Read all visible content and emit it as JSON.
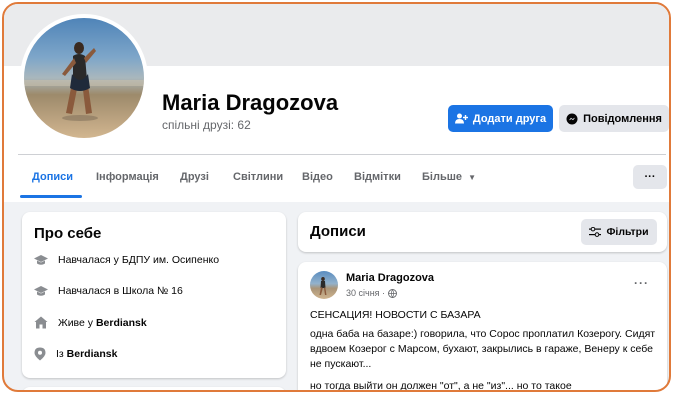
{
  "profile": {
    "name": "Maria Dragozova",
    "mutual_friends": "спільні друзі: 62"
  },
  "actions": {
    "add_friend": "Додати друга",
    "message": "Повідомлення"
  },
  "tabs": [
    {
      "label": "Дописи",
      "active": true
    },
    {
      "label": "Інформація",
      "active": false
    },
    {
      "label": "Друзі",
      "active": false
    },
    {
      "label": "Світлини",
      "active": false
    },
    {
      "label": "Відео",
      "active": false
    },
    {
      "label": "Відмітки",
      "active": false
    },
    {
      "label": "Більше",
      "active": false
    }
  ],
  "more_button": "···",
  "about": {
    "title": "Про себе",
    "items": [
      {
        "icon": "graduation-cap-icon",
        "text": "Навчалася у БДПУ им. Осипенко",
        "bold": ""
      },
      {
        "icon": "graduation-cap-icon",
        "text": "Навчалася в Школа № 16",
        "bold": ""
      },
      {
        "icon": "home-icon",
        "text": "Живе у ",
        "bold": "Berdiansk"
      },
      {
        "icon": "location-pin-icon",
        "text": "Із ",
        "bold": "Berdiansk"
      }
    ]
  },
  "posts_header": {
    "title": "Дописи",
    "filter": "Фільтри"
  },
  "post": {
    "author": "Maria Dragozova",
    "date": "30 січня ·",
    "more": "···",
    "headline": "СЕНСАЦИЯ! НОВОСТИ С БАЗАРА",
    "body": "одна баба на базаре:) говорила, что Сорос проплатил Козерогу. Сидят вдвоем Козерог с Марсом, бухают, закрылись в гараже, Венеру к себе не пускают...",
    "body2": "но тогда выйти он должен \"от\", а не \"из\"... но то такое"
  },
  "colors": {
    "accent": "#1b74e4",
    "frame_border": "#e07a3a",
    "page_bg": "#f0f2f5",
    "button_gray": "#e4e6eb"
  }
}
